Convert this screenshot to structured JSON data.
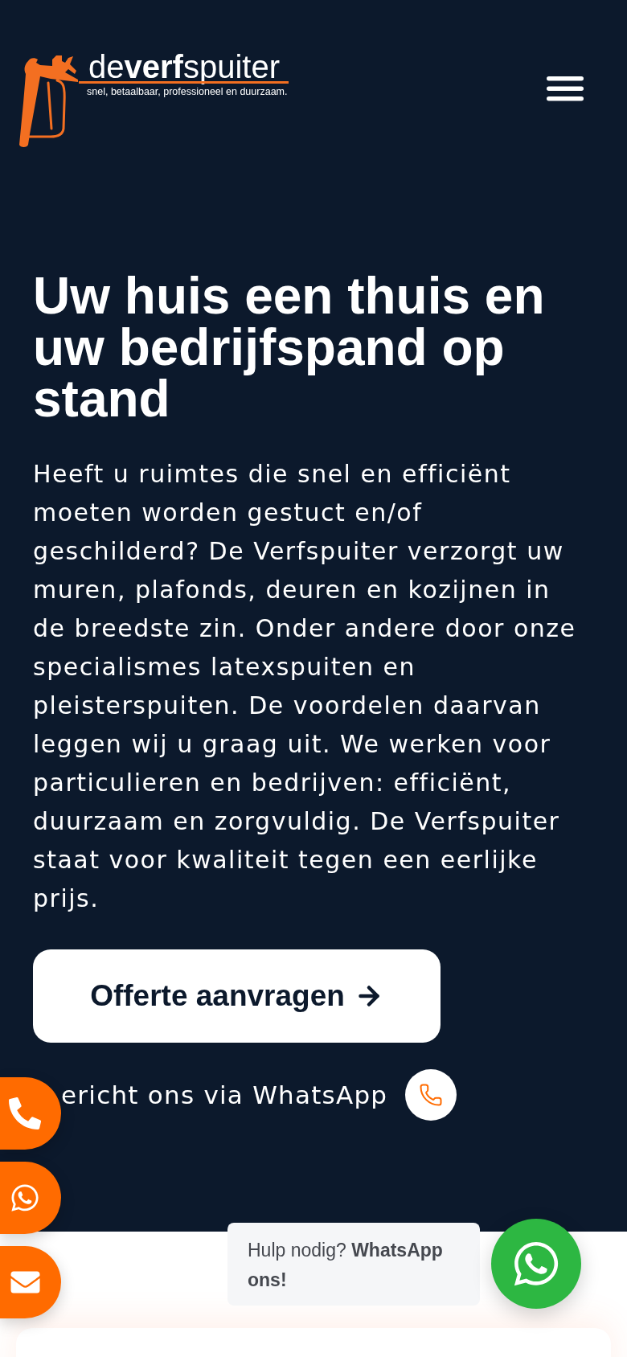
{
  "header": {
    "logo": {
      "wordmark": "de**verf**spuiter",
      "tagline": "snel, betaalbaar, professioneel en duurzaam."
    }
  },
  "hero": {
    "title": "Uw huis een thuis en uw bedrijfspand op stand",
    "text": "Heeft u ruimtes die snel en efficiënt moeten worden gestuct en/of geschilderd? De Verfspuiter verzorgt uw muren, plafonds, deuren en kozijnen in de breedste zin. Onder andere door onze specialismes latexspuiten en pleisterspuiten. De voordelen daarvan leggen wij u graag uit. We werken voor particulieren en bedrijven: efficiënt, duurzaam en zorgvuldig. De Verfspuiter staat voor kwaliteit tegen een eerlijke prijs.",
    "cta": "Offerte aanvragen",
    "whatsapp_text": "ericht ons via WhatsApp"
  },
  "floating_contacts": [
    {
      "kind": "phone"
    },
    {
      "kind": "whatsapp"
    },
    {
      "kind": "email"
    }
  ],
  "chat_widget": {
    "message": "Hulp nodig? **WhatsApp ons!**"
  }
}
